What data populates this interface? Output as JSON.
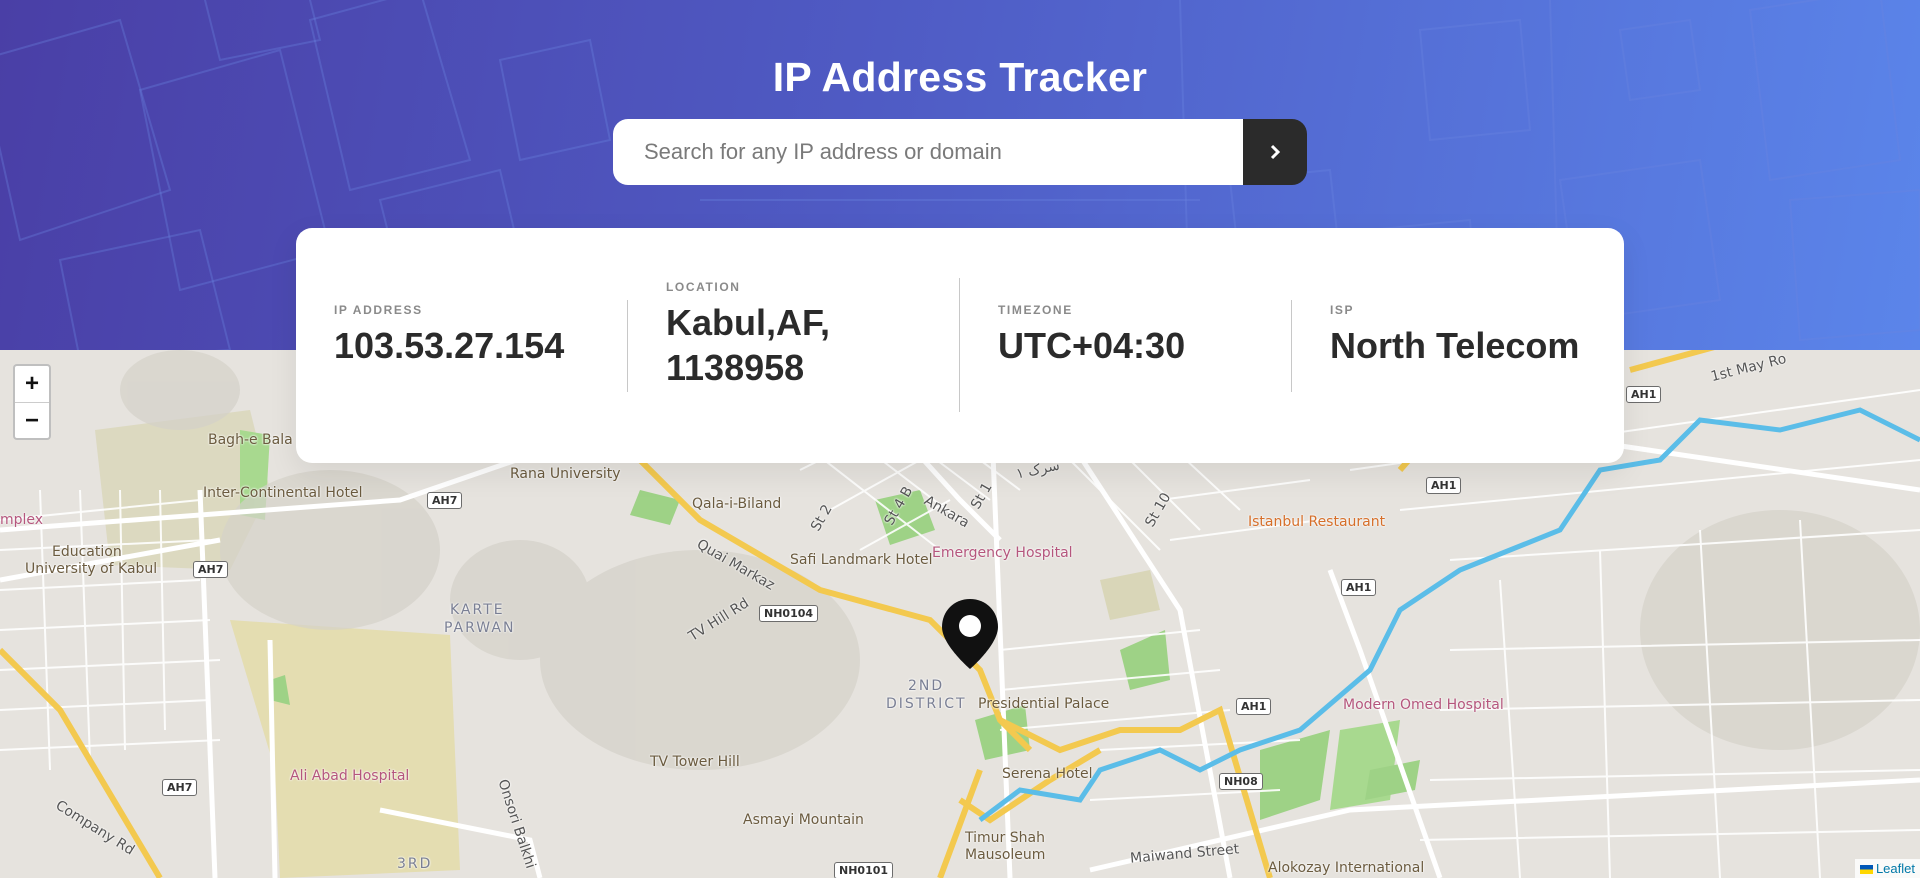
{
  "header": {
    "title": "IP Address Tracker",
    "search_placeholder": "Search for any IP address or domain",
    "search_value": "",
    "submit_icon": "chevron-right-icon"
  },
  "info": {
    "ip_label": "IP ADDRESS",
    "ip_value": "103.53.27.154",
    "location_label": "LOCATION",
    "location_line1": "Kabul,AF,",
    "location_line2": "1138958",
    "timezone_label": "TIMEZONE",
    "timezone_value": "UTC+04:30",
    "isp_label": "ISP",
    "isp_value": "North Telecom"
  },
  "map": {
    "zoom_in": "+",
    "zoom_out": "−",
    "attribution": "Leaflet",
    "marker_icon": "location-pin-icon",
    "labels": {
      "bagh_e_bala": "Bagh-e Bala",
      "rana_university": "Rana University",
      "inter_continental": "Inter-Continental Hotel",
      "complex": "mplex",
      "education": "Education",
      "university_kabul": "University of Kabul",
      "qala_i_biland": "Qala-i-Biland",
      "safi_landmark": "Safi Landmark Hotel",
      "emergency_hospital": "Emergency Hospital",
      "quai_markaz": "Quai Markaz",
      "tv_hill_rd": "TV Hill Rd",
      "karte": "KARTE",
      "parwan": "PARWAN",
      "second": "2ND",
      "district": "DISTRICT",
      "presidential_palace": "Presidential Palace",
      "istanbul_restaurant": "Istanbul Restaurant",
      "modern_omed": "Modern Omed Hospital",
      "ali_abad": "Ali Abad Hospital",
      "tv_tower_hill": "TV Tower Hill",
      "asmayi_mountain": "Asmayi Mountain",
      "serena_hotel": "Serena Hotel",
      "timur_shah": "Timur Shah",
      "mausoleum": "Mausoleum",
      "maiwand_street": "Maiwand Street",
      "alokozay": "Alokozay International",
      "third": "3RD",
      "company_rd": "Company Rd",
      "onsori_balkhi": "Onsori Balkhi",
      "first_may": "1st May Ro",
      "st2": "St 2",
      "st4b": "St 4 B",
      "st1": "St 1",
      "st10": "St 10",
      "ankara": "Ankara",
      "sarak": "سرک ۱"
    },
    "shields": {
      "ah7_a": "AH7",
      "ah7_b": "AH7",
      "ah7_c": "AH7",
      "nh0104": "NH0104",
      "ah1_a": "AH1",
      "ah1_b": "AH1",
      "ah1_c": "AH1",
      "ah1_d": "AH1",
      "nh08": "NH08",
      "nh0101": "NH0101"
    }
  },
  "colors": {
    "header_start": "#4a3fa6",
    "header_end": "#5b85ea",
    "dark": "#2b2b2b",
    "label_gray": "#8a8a8a"
  }
}
